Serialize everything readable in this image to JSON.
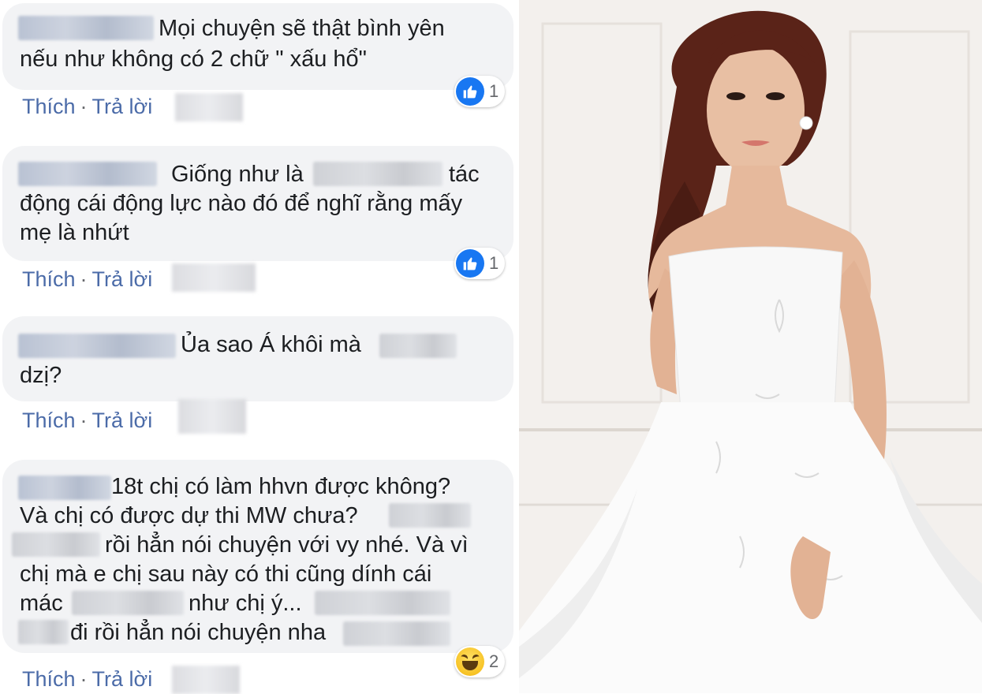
{
  "comments": [
    {
      "lines": [
        "Mọi chuyện sẽ thật bình yên",
        "nếu như không có 2 chữ \" xấu hổ\""
      ],
      "reaction": {
        "type": "like-icon",
        "count": "1"
      }
    },
    {
      "lines": [
        "Giống như là",
        "tác",
        "động cái động lực nào đó để nghĩ rằng mấy",
        "mẹ là nhứt"
      ],
      "reaction": {
        "type": "like-icon",
        "count": "1"
      }
    },
    {
      "lines": [
        "Ủa sao Á khôi mà",
        "dzị?"
      ],
      "reaction": null
    },
    {
      "lines": [
        "18t chị có làm hhvn được không?",
        "Và chị có được dự thi MW chưa?",
        "rồi hẳn nói chuyện với vy nhé. Và vì",
        "chị mà e chị sau này có thi cũng dính cái",
        "mác",
        "như chị ý...",
        "đi rồi hẳn nói chuyện nha"
      ],
      "reaction": {
        "type": "haha-icon",
        "count": "2"
      }
    }
  ],
  "actions": {
    "like": "Thích",
    "reply": "Trả lời",
    "separator": "·"
  },
  "colors": {
    "bubble": "#f2f3f5",
    "link": "#4b6ba8",
    "like_blue": "#1877f2"
  }
}
